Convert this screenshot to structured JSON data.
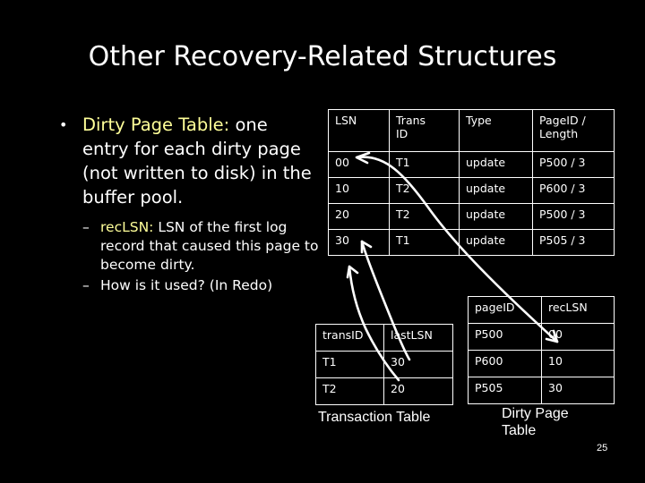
{
  "slide": {
    "title": "Other Recovery-Related Structures",
    "page_number": "25",
    "background_color": "#000000",
    "text_color": "#ffffff",
    "highlight_color": "#ffff99"
  },
  "bullets": {
    "level1": {
      "marker": "•",
      "highlight": "Dirty Page Table:",
      "rest": " one entry for each dirty page (not written to disk) in the buffer pool."
    },
    "level2": [
      {
        "marker": "–",
        "highlight": "recLSN:",
        "rest": " LSN of the first log record that caused this page to become dirty."
      },
      {
        "marker": "–",
        "highlight": "",
        "rest": "How is it used? (In Redo)"
      }
    ]
  },
  "log_table": {
    "name": "log-record-table",
    "headers": [
      "LSN",
      "Trans ID",
      "Type",
      "PageID / Length"
    ],
    "header_lines": [
      [
        "LSN"
      ],
      [
        "Trans",
        "ID"
      ],
      [
        "Type"
      ],
      [
        "PageID /",
        "Length"
      ]
    ],
    "rows": [
      [
        "00",
        "T1",
        "update",
        "P500 / 3"
      ],
      [
        "10",
        "T2",
        "update",
        "P600 / 3"
      ],
      [
        "20",
        "T2",
        "update",
        "P500 / 3"
      ],
      [
        "30",
        "T1",
        "update",
        "P505 / 3"
      ]
    ]
  },
  "transaction_table": {
    "name": "transaction-table",
    "caption": "Transaction Table",
    "headers": [
      "transID",
      "lastLSN"
    ],
    "rows": [
      [
        "T1",
        "30"
      ],
      [
        "T2",
        "20"
      ]
    ]
  },
  "dirty_page_table": {
    "name": "dirty-page-table",
    "caption_lines": [
      "Dirty Page",
      "Table"
    ],
    "headers": [
      "pageID",
      "recLSN"
    ],
    "rows": [
      [
        "P500",
        "00"
      ],
      [
        "P600",
        "10"
      ],
      [
        "P505",
        "30"
      ]
    ]
  },
  "annotations": {
    "arrow_color": "#ffffff",
    "arrows": [
      {
        "name": "arrow-lastlsn-t1-to-lsn-30",
        "from": "transaction-table lastLSN 30",
        "to": "log LSN 30"
      },
      {
        "name": "arrow-lastlsn-t2-to-lsn-20",
        "from": "transaction-table lastLSN 20",
        "to": "log LSN 20"
      },
      {
        "name": "arrow-lsn-00-to-reclsn-p500",
        "from": "log LSN 00 row",
        "to": "dirty-page-table recLSN 00"
      }
    ]
  }
}
